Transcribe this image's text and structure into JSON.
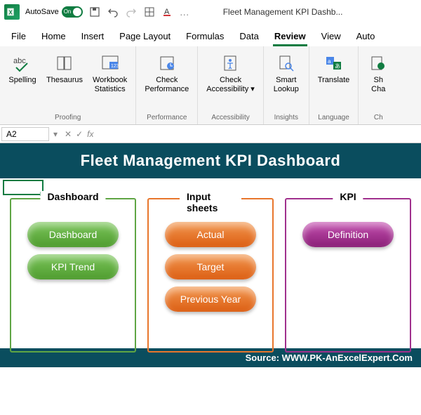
{
  "titlebar": {
    "autosave_label": "AutoSave",
    "autosave_state": "On",
    "title": "Fleet Management KPI Dashb..."
  },
  "tabs": {
    "file": "File",
    "home": "Home",
    "insert": "Insert",
    "page_layout": "Page Layout",
    "formulas": "Formulas",
    "data": "Data",
    "review": "Review",
    "view": "View",
    "automate": "Auto"
  },
  "ribbon": {
    "proofing": {
      "label": "Proofing",
      "spelling": "Spelling",
      "thesaurus": "Thesaurus",
      "workbook_stats": "Workbook\nStatistics"
    },
    "performance": {
      "label": "Performance",
      "check_perf": "Check\nPerformance"
    },
    "accessibility": {
      "label": "Accessibility",
      "check_access": "Check\nAccessibility"
    },
    "insights": {
      "label": "Insights",
      "smart_lookup": "Smart\nLookup"
    },
    "language": {
      "label": "Language",
      "translate": "Translate"
    },
    "changes": {
      "label": "Ch",
      "show_changes": "Sh\nCha"
    }
  },
  "namebox": {
    "ref": "A2",
    "fx": "fx"
  },
  "dashboard": {
    "title": "Fleet Management KPI Dashboard",
    "source": "Source: WWW.PK-AnExcelExpert.Com",
    "panels": {
      "dashboard": {
        "title": "Dashboard",
        "btn1": "Dashboard",
        "btn2": "KPI Trend"
      },
      "input": {
        "title": "Input sheets",
        "btn1": "Actual",
        "btn2": "Target",
        "btn3": "Previous Year"
      },
      "kpi": {
        "title": "KPI",
        "btn1": "Definition"
      }
    }
  }
}
